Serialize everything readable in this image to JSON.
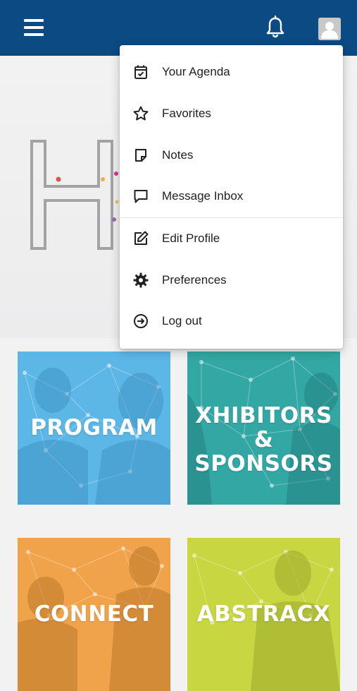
{
  "header": {
    "menu_icon": "hamburger-icon",
    "notification_icon": "bell-icon",
    "profile_icon": "user-avatar-icon",
    "background_color": "#0b4a82"
  },
  "dropdown": {
    "group1": [
      {
        "label": "Your Agenda",
        "icon": "calendar-check-icon"
      },
      {
        "label": "Favorites",
        "icon": "star-icon"
      },
      {
        "label": "Notes",
        "icon": "note-icon"
      },
      {
        "label": "Message Inbox",
        "icon": "message-icon"
      }
    ],
    "group2": [
      {
        "label": "Edit Profile",
        "icon": "edit-icon"
      },
      {
        "label": "Preferences",
        "icon": "gear-icon"
      },
      {
        "label": "Log out",
        "icon": "logout-icon"
      }
    ]
  },
  "tiles": [
    {
      "label": "PROGRAM",
      "color": "#5cb6e6"
    },
    {
      "label": "XHIBITORS &\nSPONSORS",
      "color": "#33a7a4"
    },
    {
      "label": "CONNECT",
      "color": "#f0a34a"
    },
    {
      "label": "ABSTRACX",
      "color": "#c7d641"
    }
  ]
}
